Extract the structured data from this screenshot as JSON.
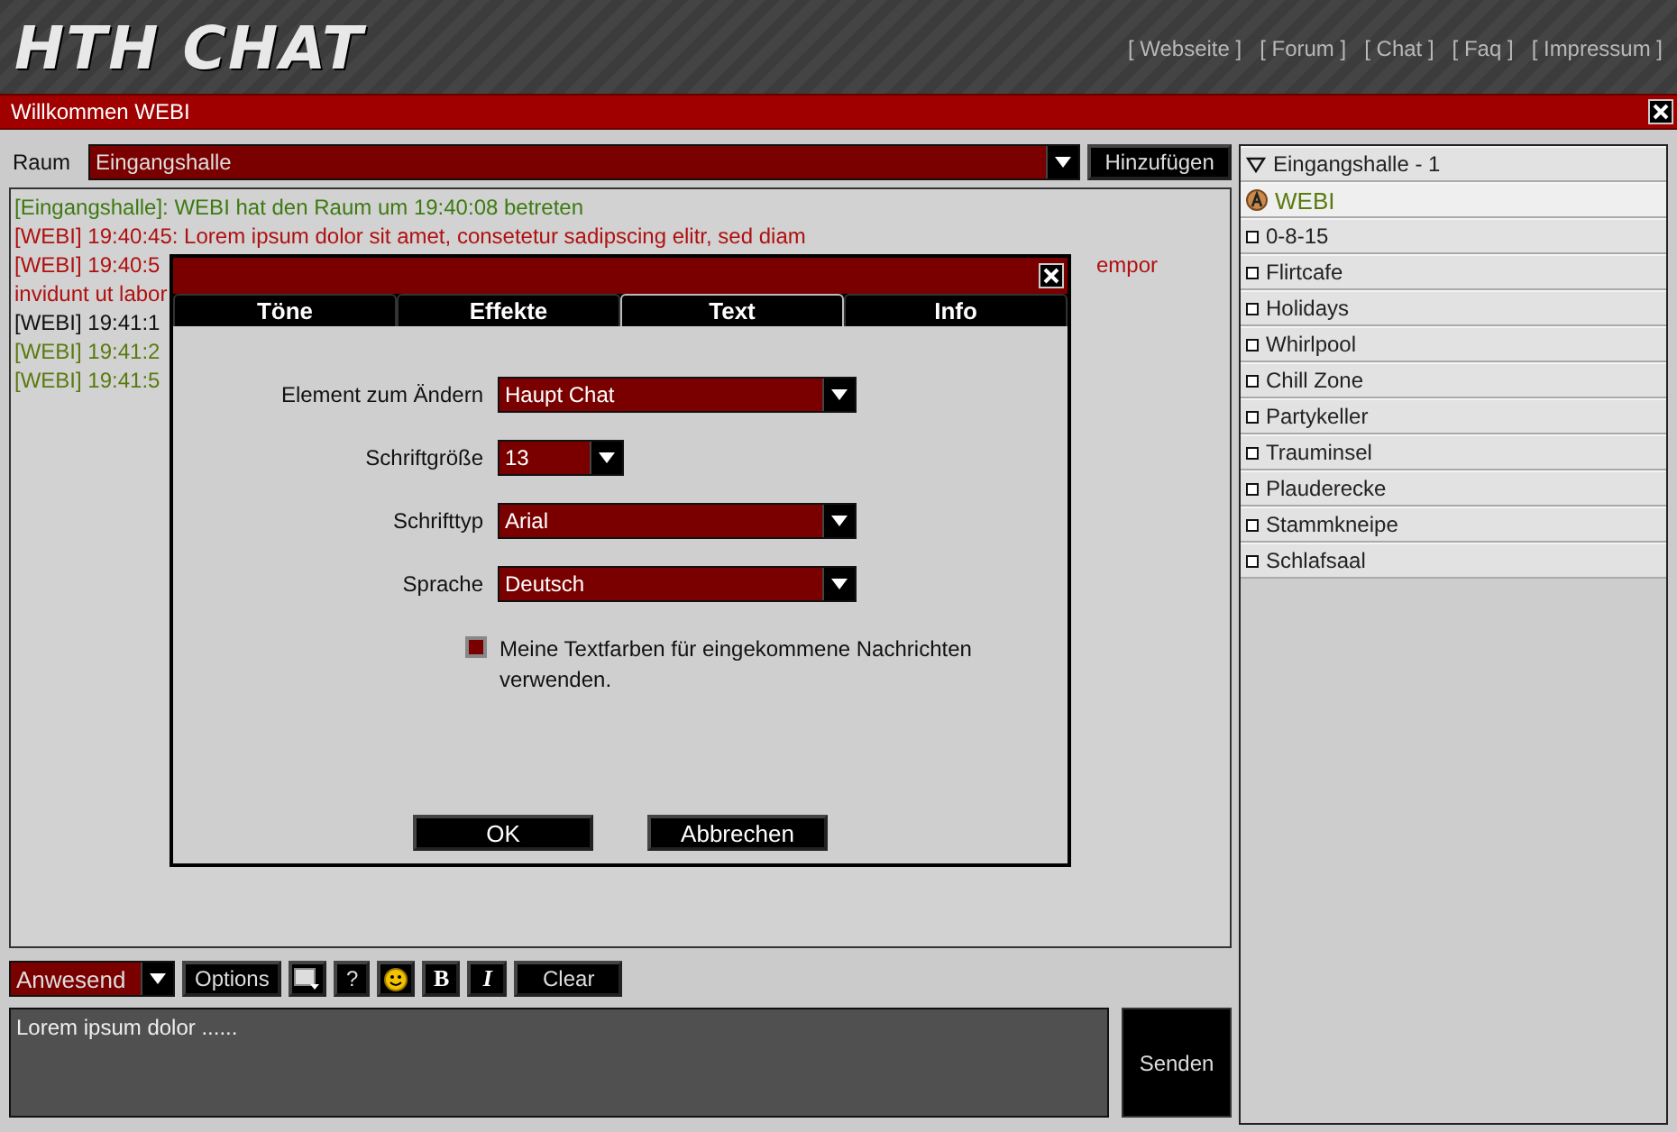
{
  "header": {
    "logo": "HTH CHAT",
    "links": [
      "[ Webseite ]",
      "[ Forum ]",
      "[ Chat ]",
      "[ Faq ]",
      "[ Impressum ]"
    ]
  },
  "welcome_bar": {
    "title": "Willkommen WEBI"
  },
  "room": {
    "label": "Raum",
    "value": "Eingangshalle",
    "add_button": "Hinzufügen"
  },
  "messages": [
    {
      "text": "[Eingangshalle]: WEBI hat den Raum um 19:40:08 betreten",
      "color": "#3d7a12"
    },
    {
      "text": "[WEBI] 19:40:45: Lorem ipsum dolor sit amet, consetetur sadipscing elitr, sed diam",
      "color": "#b01010"
    },
    {
      "text": "[WEBI] 19:40:5",
      "tail": "empor",
      "color": "#b01010"
    },
    {
      "text": "invidunt ut labor",
      "color": "#b01010"
    },
    {
      "text": "[WEBI] 19:41:1",
      "color": "#111111"
    },
    {
      "text": "[WEBI] 19:41:2",
      "color": "#5a7a10"
    },
    {
      "text": "[WEBI] 19:41:5",
      "color": "#5a7a10"
    }
  ],
  "dialog": {
    "tabs": [
      {
        "label": "Töne",
        "selected": false
      },
      {
        "label": "Effekte",
        "selected": false
      },
      {
        "label": "Text",
        "selected": true
      },
      {
        "label": "Info",
        "selected": false
      }
    ],
    "fields": [
      {
        "label": "Element zum Ändern",
        "value": "Haupt Chat",
        "kind": "wide"
      },
      {
        "label": "Schriftgröße",
        "value": "13",
        "kind": "narrow"
      },
      {
        "label": "Schrifttyp",
        "value": "Arial",
        "kind": "wide"
      },
      {
        "label": "Sprache",
        "value": "Deutsch",
        "kind": "wide"
      }
    ],
    "checkbox": {
      "label": "Meine Textfarben für eingekommene Nachrichten verwenden.",
      "checked": false
    },
    "buttons": [
      "OK",
      "Abbrechen"
    ]
  },
  "toolbar": {
    "status": "Anwesend",
    "options": "Options",
    "help": "?",
    "bold": "B",
    "italic": "I",
    "clear": "Clear"
  },
  "message_input": {
    "value": "Lorem ipsum dolor ......"
  },
  "send_button": "Senden",
  "sidebar": {
    "current_room": {
      "label": "Eingangshalle - 1",
      "expanded": true,
      "users": [
        "WEBI"
      ]
    },
    "rooms": [
      "0-8-15",
      "Flirtcafe",
      "Holidays",
      "Whirlpool",
      "Chill Zone",
      "Partykeller",
      "Trauminsel",
      "Plauderecke",
      "Stammkneipe",
      "Schlafsaal"
    ]
  }
}
